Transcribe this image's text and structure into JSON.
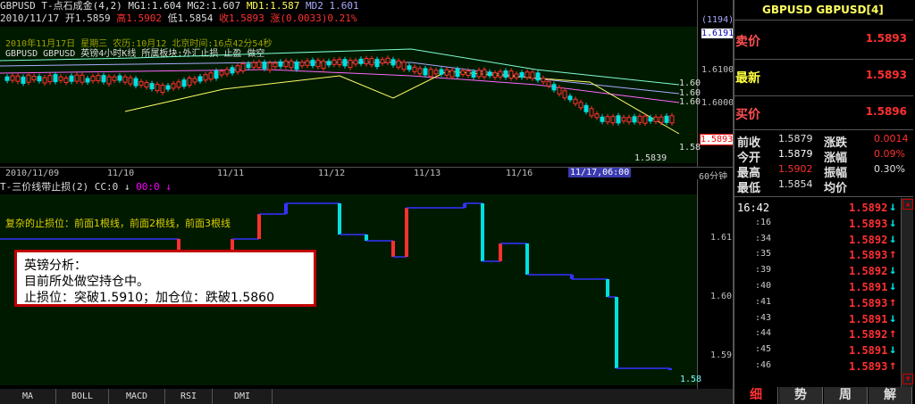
{
  "main_chart": {
    "header_line1": "GBPUSD T-点石成金(4,2)",
    "ma1": "MG1:1.604",
    "ma2": "MG2:1.607",
    "ma3": "MD1:1.587",
    "ma4": "MD2 1.601",
    "info_line": "2010/11/17 开1.5859",
    "high": "高1.5902",
    "low": "低1.5854",
    "close": "收1.5893",
    "change": "涨(0.0033)0.21%",
    "overlay_time": "2010年11月17日 星期三 农历:10月12 北京时间:16点42分54秒",
    "overlay_sub": "GBPUSD GBPUSD 英镑4小时K线 所属板块:外汇止损 止盈 做空",
    "price_ticks": [
      "(1194)",
      "1.6191",
      "1.6100",
      "1.6000",
      "1.5893",
      "1.5839"
    ],
    "right_labels": [
      "1.60",
      "1.60",
      "1.60",
      "1.58"
    ],
    "dates": [
      "2010/11/09",
      "11/10",
      "11/11",
      "11/12",
      "11/13",
      "11/16",
      "11/17,06:00"
    ],
    "period": "60分钟"
  },
  "sub_chart": {
    "header": "T-三价线带止损(2)",
    "cc": "CC:0",
    "val2": "00:0",
    "note": "复杂的止损位：前面1根线，前面2根线，前面3根线",
    "price_ticks": [
      "1.61",
      "1.60",
      "1.59",
      "1.58"
    ]
  },
  "analysis_box": {
    "line1": "英镑分析：",
    "line2": "目前所处做空持仓中。",
    "line3": "止损位：突破1.5910；加仓位：跌破1.5860"
  },
  "bottom_tabs": [
    "MA",
    "BOLL",
    "MACD",
    "RSI",
    "DMI"
  ],
  "quote_panel": {
    "title": "GBPUSD GBPUSD[4]",
    "sell_label": "卖价",
    "sell": "1.5893",
    "latest_label": "最新",
    "latest": "1.5893",
    "buy_label": "买价",
    "buy": "1.5896",
    "stats": [
      {
        "l1": "前收",
        "v1": "1.5879",
        "l2": "涨跌",
        "v2": "0.0014"
      },
      {
        "l1": "今开",
        "v1": "1.5879",
        "l2": "涨幅",
        "v2": "0.09%"
      },
      {
        "l1": "最高",
        "v1": "1.5902",
        "l2": "振幅",
        "v2": "0.30%"
      },
      {
        "l1": "最低",
        "v1": "1.5854",
        "l2": "均价",
        "v2": ""
      }
    ],
    "ticks": [
      {
        "t": "16:42",
        "p": "1.5892",
        "d": "down"
      },
      {
        "t": ":16",
        "p": "1.5893",
        "d": "down"
      },
      {
        "t": ":34",
        "p": "1.5892",
        "d": "down"
      },
      {
        "t": ":35",
        "p": "1.5893",
        "d": "up"
      },
      {
        "t": ":39",
        "p": "1.5892",
        "d": "down"
      },
      {
        "t": ":40",
        "p": "1.5891",
        "d": "down"
      },
      {
        "t": ":41",
        "p": "1.5893",
        "d": "up"
      },
      {
        "t": ":43",
        "p": "1.5891",
        "d": "down"
      },
      {
        "t": ":44",
        "p": "1.5892",
        "d": "up"
      },
      {
        "t": ":45",
        "p": "1.5891",
        "d": "down"
      },
      {
        "t": ":46",
        "p": "1.5893",
        "d": "up"
      }
    ],
    "tabs": [
      "细",
      "势",
      "周",
      "解"
    ]
  },
  "colors": {
    "up": "#ff3030",
    "down": "#00e0e0",
    "panel_bg": "#001a00"
  }
}
